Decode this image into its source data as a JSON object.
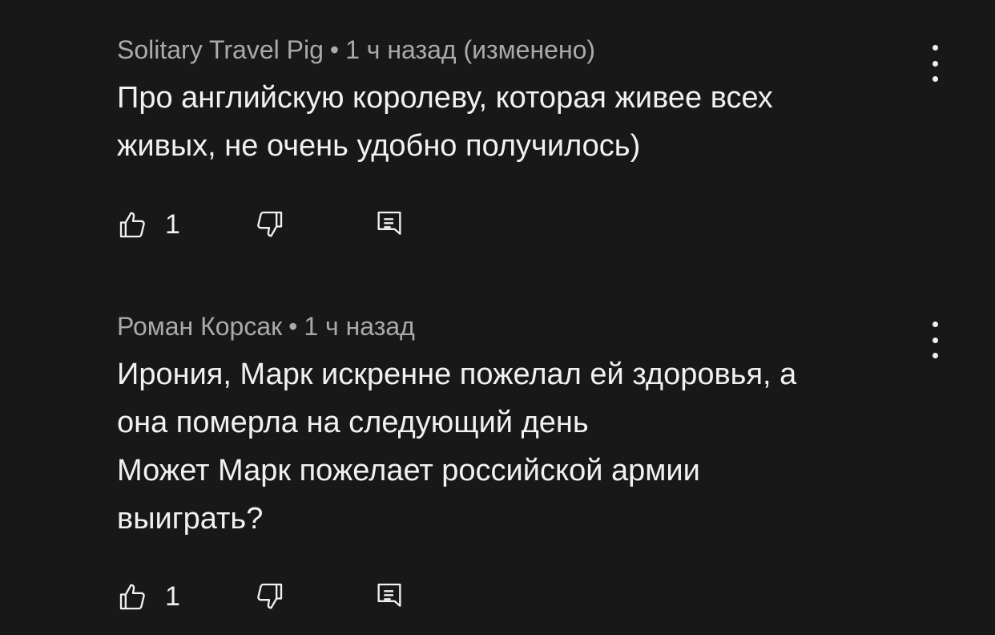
{
  "comments": [
    {
      "author": "Solitary Travel Pig",
      "separator": "•",
      "time": "1 ч назад (изменено)",
      "lines": [
        "Про английскую королеву,  которая живее всех",
        "живых, не очень удобно получилось)"
      ],
      "like_count": "1",
      "icons": {
        "like": "thumbs-up-icon",
        "dislike": "thumbs-down-icon",
        "reply": "reply-comment-icon",
        "menu": "more-vert-icon"
      }
    },
    {
      "author": "Роман Корсак",
      "separator": "•",
      "time": "1 ч назад",
      "lines": [
        "Ирония, Марк искренне пожелал ей здоровья, а",
        "она померла на следующий день",
        "Может Марк пожелает российской армии",
        "выиграть?"
      ],
      "like_count": "1",
      "icons": {
        "like": "thumbs-up-icon",
        "dislike": "thumbs-down-icon",
        "reply": "reply-comment-icon",
        "menu": "more-vert-icon"
      }
    }
  ],
  "colors": {
    "background": "#181818",
    "text_primary": "#f1f1f1",
    "text_secondary": "#aaaaaa"
  }
}
